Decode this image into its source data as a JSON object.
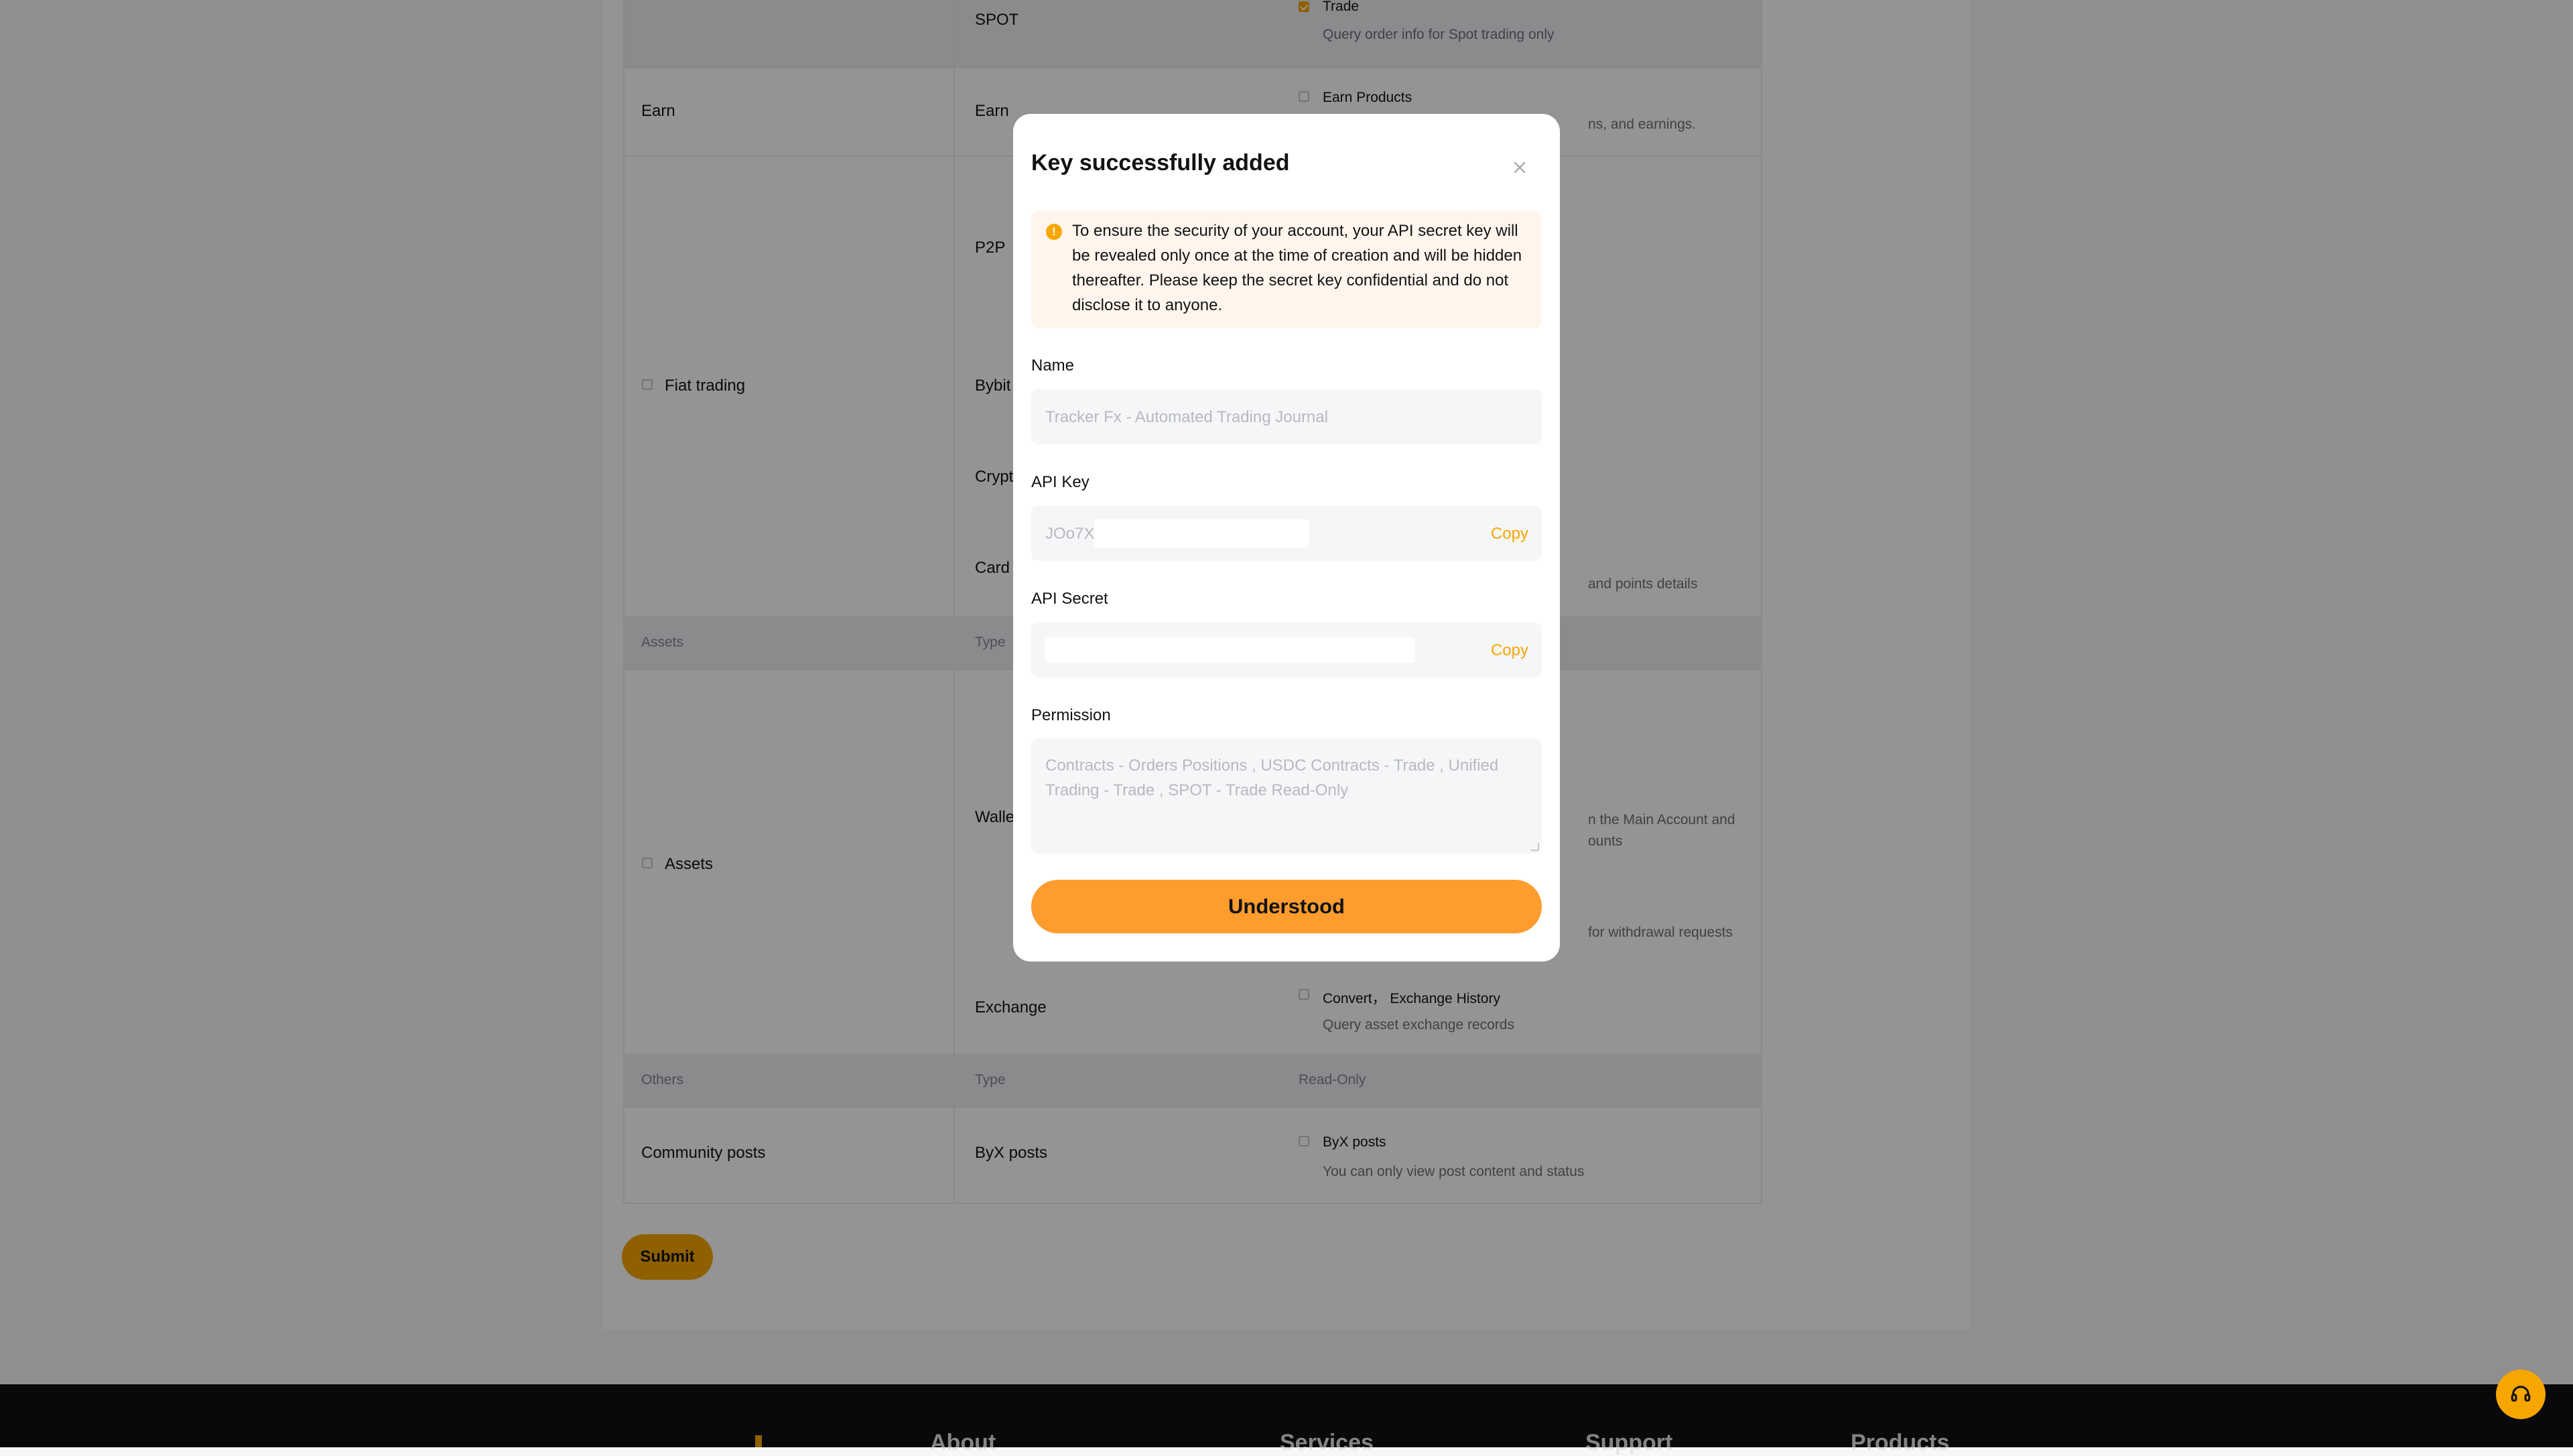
{
  "table": {
    "spot_row": {
      "type": "SPOT",
      "perm": "Trade",
      "desc": "Query order info for Spot trading only"
    },
    "earn_row": {
      "category": "Earn",
      "type": "Earn",
      "perm": "Earn Products",
      "desc_partial": "ns, and earnings."
    },
    "fiat_row": {
      "category": "Fiat trading",
      "types": [
        "P2P",
        "Bybit",
        "Crypt",
        "Card"
      ],
      "card_desc_partial": "and points details"
    },
    "assets_header": {
      "col1": "Assets",
      "col2": "Type"
    },
    "assets_row": {
      "category": "Assets",
      "type": "Walle",
      "wallet_desc_partial_1": "n the Main Account and",
      "wallet_desc_partial_2": "ounts",
      "withdraw_desc_partial": "for withdrawal requests",
      "exchange_type": "Exchange",
      "exchange_perm": "Convert，  Exchange History",
      "exchange_desc": "Query asset exchange records"
    },
    "others_header": {
      "col1": "Others",
      "col2": "Type",
      "col3": "Read-Only"
    },
    "community_row": {
      "category": "Community posts",
      "type": "ByX posts",
      "perm": "ByX posts",
      "desc": "You can only view post content and status"
    }
  },
  "submit_label": "Submit",
  "footer": {
    "columns": [
      "About",
      "Services",
      "Support",
      "Products"
    ]
  },
  "modal": {
    "title": "Key successfully added",
    "notice": "To ensure the security of your account, your API secret key will be revealed only once at the time of creation and will be hidden thereafter. Please keep the secret key confidential and do not disclose it to anyone.",
    "name_label": "Name",
    "name_value": "Tracker Fx - Automated Trading Journal",
    "api_key_label": "API Key",
    "api_key_value": "JOo7X",
    "api_secret_label": "API Secret",
    "copy_label": "Copy",
    "permission_label": "Permission",
    "permission_value": "Contracts - Orders Positions , USDC Contracts - Trade , Unified Trading - Trade , SPOT - Trade  Read-Only",
    "button_label": "Understood"
  },
  "colors": {
    "accent": "#f7a600",
    "button": "#ff9c2e",
    "notice_bg": "#fff5ec"
  }
}
